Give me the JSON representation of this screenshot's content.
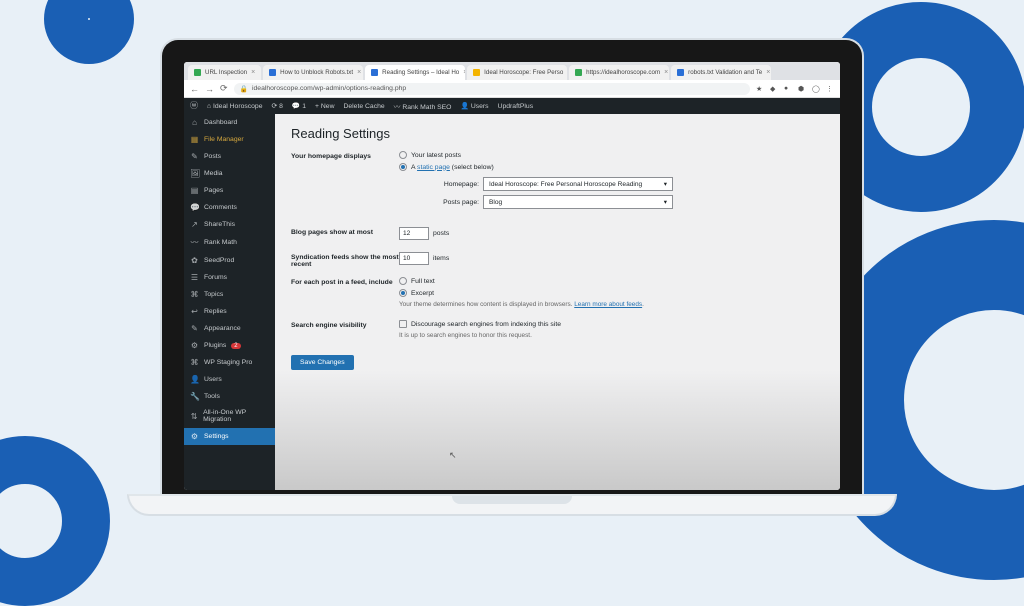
{
  "browser": {
    "tabs": [
      {
        "label": "URL Inspection",
        "fav": "grn"
      },
      {
        "label": "How to Unblock Robots.txt",
        "fav": "blu"
      },
      {
        "label": "Reading Settings – Ideal Ho",
        "fav": "blu",
        "active": true
      },
      {
        "label": "Ideal Horoscope: Free Perso",
        "fav": "org"
      },
      {
        "label": "https://idealhoroscope.com",
        "fav": "grn"
      },
      {
        "label": "robots.txt Validation and Te",
        "fav": "blu"
      }
    ],
    "url": "idealhoroscope.com/wp-admin/options-reading.php"
  },
  "wpbar": {
    "site": "Ideal Horoscope",
    "updates": "8",
    "comments": "1",
    "new": "New",
    "cache": "Delete Cache",
    "rankmath": "Rank Math SEO",
    "users": "Users",
    "updraft": "UpdraftPlus"
  },
  "sidebar": {
    "items": [
      {
        "icon": "⌂",
        "label": "Dashboard"
      },
      {
        "icon": "📁",
        "label": "File Manager",
        "cls": "file"
      },
      {
        "icon": "✎",
        "label": "Posts"
      },
      {
        "icon": "🖼",
        "label": "Media"
      },
      {
        "icon": "▤",
        "label": "Pages"
      },
      {
        "icon": "💬",
        "label": "Comments"
      },
      {
        "icon": "↗",
        "label": "ShareThis"
      },
      {
        "icon": "〰",
        "label": "Rank Math"
      },
      {
        "icon": "✿",
        "label": "SeedProd"
      },
      {
        "icon": "☰",
        "label": "Forums"
      },
      {
        "icon": "⌘",
        "label": "Topics"
      },
      {
        "icon": "↩",
        "label": "Replies"
      },
      {
        "icon": "✎",
        "label": "Appearance"
      },
      {
        "icon": "⚙",
        "label": "Plugins",
        "badge": "2"
      },
      {
        "icon": "⌘",
        "label": "WP Staging Pro"
      },
      {
        "icon": "👤",
        "label": "Users"
      },
      {
        "icon": "🔧",
        "label": "Tools"
      },
      {
        "icon": "⇅",
        "label": "All-in-One WP Migration"
      },
      {
        "icon": "⚙",
        "label": "Settings",
        "active": true
      }
    ]
  },
  "page": {
    "title": "Reading Settings",
    "homepage_displays": "Your homepage displays",
    "opt_latest": "Your latest posts",
    "opt_static": "A ",
    "static_link": "static page",
    "static_after": " (select below)",
    "homepage_label": "Homepage:",
    "homepage_value": "Ideal Horoscope: Free Personal Horoscope Reading",
    "posts_label": "Posts page:",
    "posts_value": "Blog",
    "blog_pages_label": "Blog pages show at most",
    "blog_pages_value": "12",
    "blog_pages_unit": "posts",
    "synd_label": "Syndication feeds show the most recent",
    "synd_value": "10",
    "synd_unit": "items",
    "feed_label": "For each post in a feed, include",
    "feed_full": "Full text",
    "feed_excerpt": "Excerpt",
    "feed_note_a": "Your theme determines how content is displayed in browsers. ",
    "feed_note_link": "Learn more about feeds",
    "sev_label": "Search engine visibility",
    "sev_chk": "Discourage search engines from indexing this site",
    "sev_note": "It is up to search engines to honor this request.",
    "save": "Save Changes"
  }
}
